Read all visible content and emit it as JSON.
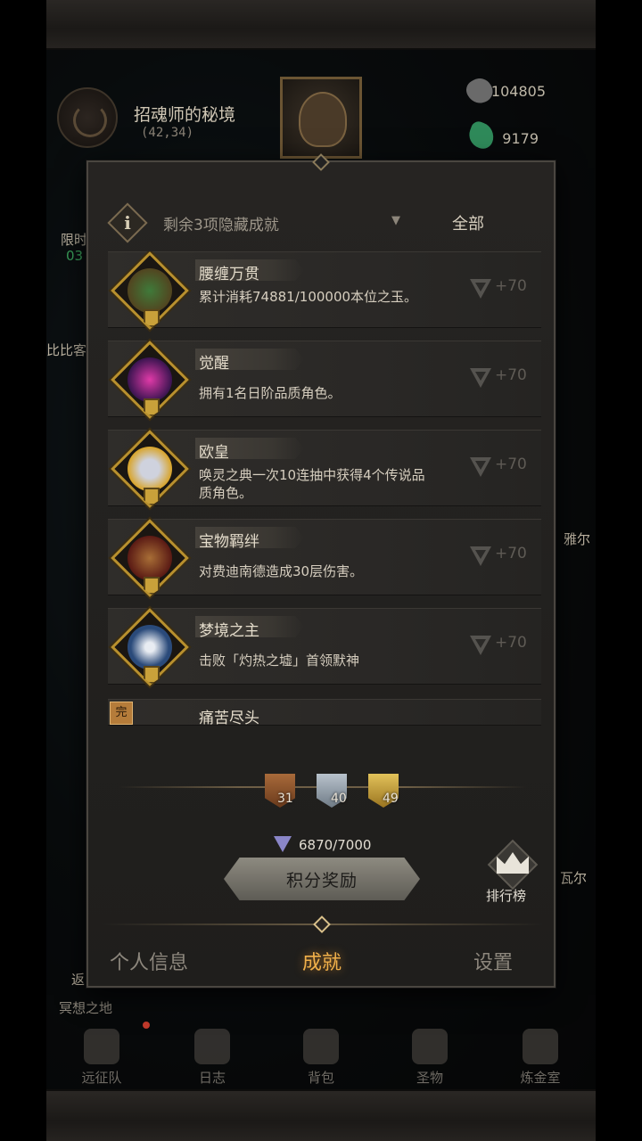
{
  "header": {
    "map_name": "招魂师的秘境",
    "coordinates": "(42,34)",
    "currency_stone": "104805",
    "currency_jade": "9179"
  },
  "background_hints": {
    "left_1": "限时",
    "left_2": "03",
    "left_3": "比比客",
    "right_1": "雅尔",
    "right_2": "瓦尔",
    "bottom_left": "返",
    "meditation": "冥想之地"
  },
  "modal": {
    "filter_label": "剩余3项隐藏成就",
    "filter_all": "全部",
    "achievements": [
      {
        "title": "腰缠万贯",
        "desc": "累计消耗74881/100000本位之玉。",
        "reward": "+70",
        "icon": "treasure-chest-icon"
      },
      {
        "title": "觉醒",
        "desc": "拥有1名日阶品质角色。",
        "reward": "+70",
        "icon": "purple-orb-icon"
      },
      {
        "title": "欧皇",
        "desc": "唤灵之典一次10连抽中获得4个传说品质角色。",
        "reward": "+70",
        "icon": "crowned-king-icon"
      },
      {
        "title": "宝物羁绊",
        "desc": "对费迪南德造成30层伤害。",
        "reward": "+70",
        "icon": "treasure-pouch-icon"
      },
      {
        "title": "梦境之主",
        "desc": "击败「灼热之墟」首领默神",
        "reward": "+70",
        "icon": "dream-spire-icon"
      },
      {
        "title": "痛苦尽头",
        "complete_tag": "完"
      }
    ],
    "medals": {
      "bronze": "31",
      "silver": "40",
      "gold": "49"
    },
    "points": "6870/7000",
    "reward_button": "积分奖励",
    "ranking": "排行榜",
    "tabs": {
      "personal": "个人信息",
      "achievements": "成就",
      "settings": "设置"
    }
  },
  "bottom_nav": [
    {
      "label": "远征队",
      "icon": "helmet-icon"
    },
    {
      "label": "日志",
      "icon": "scroll-icon"
    },
    {
      "label": "背包",
      "icon": "backpack-icon"
    },
    {
      "label": "圣物",
      "icon": "relic-icon"
    },
    {
      "label": "炼金室",
      "icon": "alchemy-icon"
    }
  ],
  "colors": {
    "active_tab": "#f0b04a",
    "badge_gold": "#b8902e",
    "panel_bg": "#262422"
  }
}
